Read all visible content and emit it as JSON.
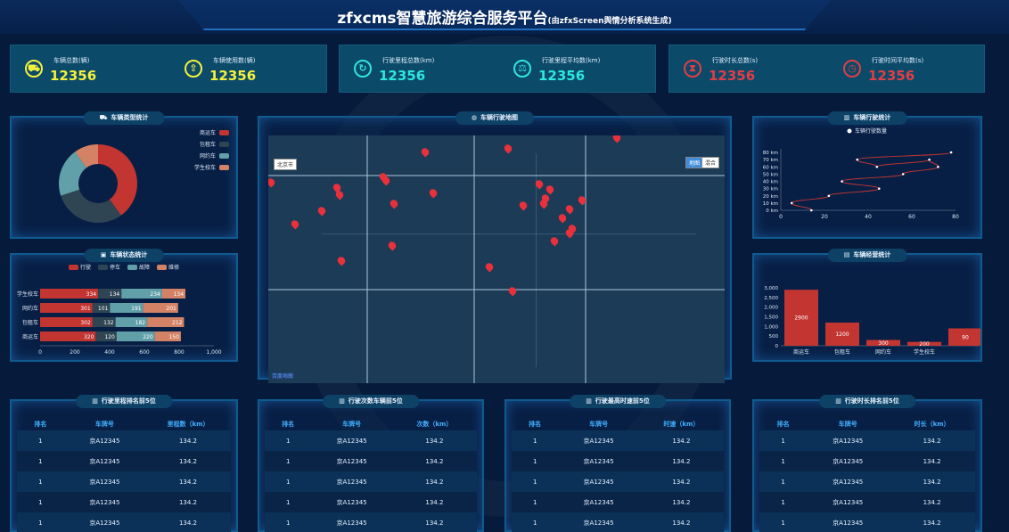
{
  "header": {
    "title": "zfxcms智慧旅游综合服务平台",
    "subtitle": "(由zfxScreen舆情分析系统生成)"
  },
  "kpis": [
    {
      "label": "车辆总数(辆)",
      "value": "12356",
      "color": "#f4f13c",
      "icon": "car-icon"
    },
    {
      "label": "车辆使用数(辆)",
      "value": "12356",
      "color": "#f4f13c",
      "icon": "upload-icon"
    },
    {
      "label": "行驶里程总数(km)",
      "value": "12356",
      "color": "#2ee6e0",
      "icon": "speed-icon"
    },
    {
      "label": "行驶里程平均数(km)",
      "value": "12356",
      "color": "#2ee6e0",
      "icon": "balance-icon"
    },
    {
      "label": "行驶时长总数(s)",
      "value": "12356",
      "color": "#e23e45",
      "icon": "hourglass-icon"
    },
    {
      "label": "行驶时间平均数(s)",
      "value": "12356",
      "color": "#e23e45",
      "icon": "clock-icon"
    }
  ],
  "panels": {
    "car_type": "车辆类型统计",
    "car_state": "车辆状态统计",
    "map": "车辆行驶地图",
    "travel": "车辆行驶统计",
    "operation": "车辆经营统计",
    "rank_mileage": "行驶里程排名前5位",
    "rank_count": "行驶次数车辆前5位",
    "rank_speed": "行驶最高时速前5位",
    "rank_duration": "行驶时长排名前5位"
  },
  "map": {
    "city": "北京市",
    "btn_map": "地图",
    "btn_hybrid": "混合",
    "logo": "百度地图"
  },
  "colors": {
    "red": "#c23531",
    "dark": "#2f4554",
    "teal": "#61a0a8",
    "orange": "#d48265"
  },
  "chart_data": [
    {
      "type": "pie",
      "title": "车辆类型统计",
      "categories": [
        "商运车",
        "包租车",
        "网约车",
        "学生校车"
      ],
      "values": [
        40,
        30,
        20,
        10
      ]
    },
    {
      "type": "bar",
      "title": "车辆状态统计",
      "orientation": "horizontal",
      "stacked": true,
      "categories": [
        "学生校车",
        "网约车",
        "包租车",
        "商运车"
      ],
      "series": [
        {
          "name": "行驶",
          "values": [
            334,
            301,
            302,
            320
          ]
        },
        {
          "name": "停车",
          "values": [
            134,
            101,
            132,
            120
          ]
        },
        {
          "name": "故障",
          "values": [
            234,
            191,
            182,
            220
          ]
        },
        {
          "name": "维修",
          "values": [
            134,
            201,
            212,
            150
          ]
        }
      ],
      "xticks": [
        "0",
        "200",
        "400",
        "600",
        "800",
        "1,000"
      ],
      "xlim": [
        0,
        1000
      ]
    },
    {
      "type": "line",
      "title": "车辆行驶统计",
      "series": [
        {
          "name": "车辆行驶数量",
          "x": [
            14,
            5,
            22,
            45,
            28,
            56,
            72,
            68,
            44,
            35,
            78
          ],
          "y": [
            0,
            10,
            20,
            30,
            40,
            50,
            60,
            70,
            60,
            70,
            80
          ]
        }
      ],
      "yticks": [
        "0 km",
        "10 km",
        "20 km",
        "30 km",
        "40 km",
        "50 km",
        "60 km",
        "70 km",
        "80 km"
      ],
      "xticks": [
        "0",
        "20",
        "40",
        "60",
        "80"
      ],
      "xlim": [
        0,
        80
      ],
      "ylim": [
        0,
        80
      ]
    },
    {
      "type": "bar",
      "title": "车辆经营统计",
      "categories": [
        "商运车",
        "包租车",
        "网约车",
        "学生校车",
        ""
      ],
      "values": [
        2900,
        1200,
        300,
        200,
        900
      ],
      "labels": [
        "2900",
        "1200",
        "300",
        "200",
        "90"
      ],
      "yticks": [
        "0",
        "500",
        "1,000",
        "1,500",
        "2,000",
        "2,500",
        "3,000"
      ],
      "ylim": [
        0,
        3000
      ]
    }
  ],
  "tables": {
    "mileage": {
      "headers": [
        "排名",
        "车牌号",
        "里程数（km）"
      ]
    },
    "count": {
      "headers": [
        "排名",
        "车牌号",
        "次数（km）"
      ]
    },
    "speed": {
      "headers": [
        "排名",
        "车牌号",
        "时速（km）"
      ]
    },
    "duration": {
      "headers": [
        "排名",
        "车牌号",
        "时长（km）"
      ]
    },
    "rows": [
      {
        "rank": "1",
        "plate": "京A12345",
        "value": "134.2"
      },
      {
        "rank": "1",
        "plate": "京A12345",
        "value": "134.2"
      },
      {
        "rank": "1",
        "plate": "京A12345",
        "value": "134.2"
      },
      {
        "rank": "1",
        "plate": "京A12345",
        "value": "134.2"
      },
      {
        "rank": "1",
        "plate": "京A12345",
        "value": "134.2"
      }
    ]
  }
}
